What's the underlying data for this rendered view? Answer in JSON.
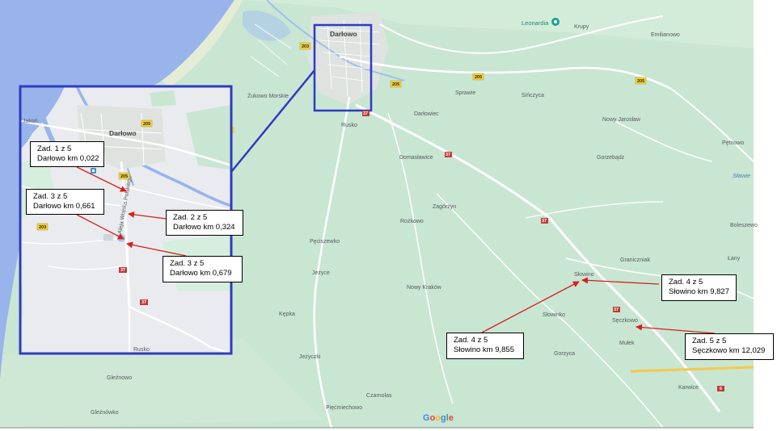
{
  "colors": {
    "land": "#c9e6d3",
    "land_light": "#d6eedd",
    "inset_bg": "#e9ebee",
    "water": "#98b4eb",
    "road": "#ffffff",
    "highway": "#f6c84a",
    "frame": "#2f3bc0",
    "arrow": "#d81e1e",
    "shield_yellow": "#f5d23c",
    "shield_red": "#c23a3a"
  },
  "map": {
    "places": {
      "darlowo": "Darłowo",
      "zukowo_morskie": "Żukowo Morskie",
      "rusko": "Rusko",
      "sprawie": "Sprawie",
      "sinczyca": "Sińczyca",
      "darlowiec": "Darłowiec",
      "domaslawice": "Domasławice",
      "krupy": "Krupy",
      "emilianowo": "Emilianowo",
      "nowy_jaroslaw": "Nowy Jarosław",
      "gorzebadz": "Gorzebądz",
      "petnowo": "Pętnowo",
      "slawie": "Sławie",
      "zagorzyn": "Zagórzyn",
      "rozkowo": "Rożkowo",
      "boleszewo": "Boleszewo",
      "graniczniak": "Graniczniak",
      "lany": "Łany",
      "peciszewko": "Pęciszewko",
      "jezyce": "Jeżyce",
      "nowy_krakow": "Nowy Kraków",
      "slowino": "Słowino",
      "slowinko": "Słowinko",
      "seczkowo": "Sęczkowo",
      "mulek": "Mułek",
      "kepka": "Kępka",
      "gorzyca": "Gorzyca",
      "jezyczki": "Jeżyczki",
      "karwice": "Karwice",
      "czarnolas": "Czarnolas",
      "piecmiechowo": "Pięćmiechowo",
      "gleznowo": "Gleźnowo",
      "glesnowko": "Gleźnówko",
      "leonardia": "Leonardia",
      "inset_darlowo": "Darłowo",
      "inset_rusko": "Rusko",
      "inset_lakon": "Jakoń",
      "inset_street": "Aleja Wojska Polskiego"
    },
    "roads": {
      "r203": "203",
      "r205": "205",
      "r37": "37",
      "r6": "6"
    },
    "icons": [
      "poi-leonardia-icon",
      "bus-stop-icon",
      "google-logo"
    ],
    "google": [
      "G",
      "o",
      "o",
      "g",
      "l",
      "e"
    ]
  },
  "callouts": [
    {
      "line1": "Zad. 1 z 5",
      "line2": "Darłowo km 0,022"
    },
    {
      "line1": "Zad. 2 z 5",
      "line2": "Darłowo km 0,324"
    },
    {
      "line1": "Zad. 3 z 5",
      "line2": "Darłowo km 0,661"
    },
    {
      "line1": "Zad. 3 z 5",
      "line2": "Darłowo km 0,679"
    },
    {
      "line1": "Zad. 4 z 5",
      "line2": "Słowino km 9,827"
    },
    {
      "line1": "Zad. 4 z 5",
      "line2": "Słowino km 9,855"
    },
    {
      "line1": "Zad. 5 z 5",
      "line2": "Sęczkowo km 12,029"
    }
  ]
}
